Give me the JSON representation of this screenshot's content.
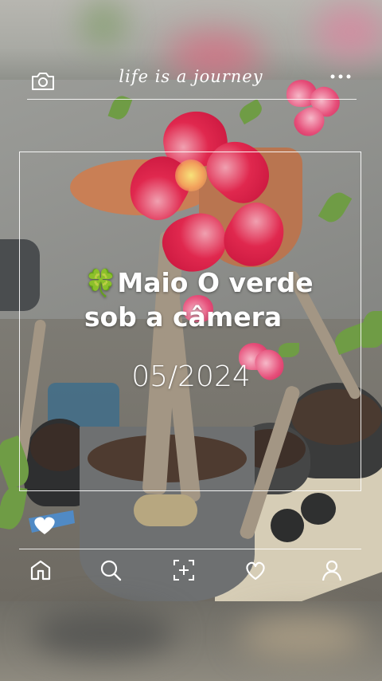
{
  "header": {
    "title": "life is a journey",
    "camera_icon": "camera-icon",
    "more_icon": "more-dots-icon"
  },
  "caption": {
    "emoji": "🍀",
    "line1": "Maio O verde",
    "line2": "sob a câmera",
    "date": "05/2024"
  },
  "like_badge": {
    "icon": "heart-icon"
  },
  "bottom_nav": {
    "items": [
      {
        "icon": "home-icon"
      },
      {
        "icon": "search-icon"
      },
      {
        "icon": "add-icon"
      },
      {
        "icon": "heart-icon"
      },
      {
        "icon": "profile-icon"
      }
    ]
  },
  "colors": {
    "overlay_line": "#ffffff",
    "flower": "#e0284e",
    "badge_blue": "#4a8fd6"
  }
}
